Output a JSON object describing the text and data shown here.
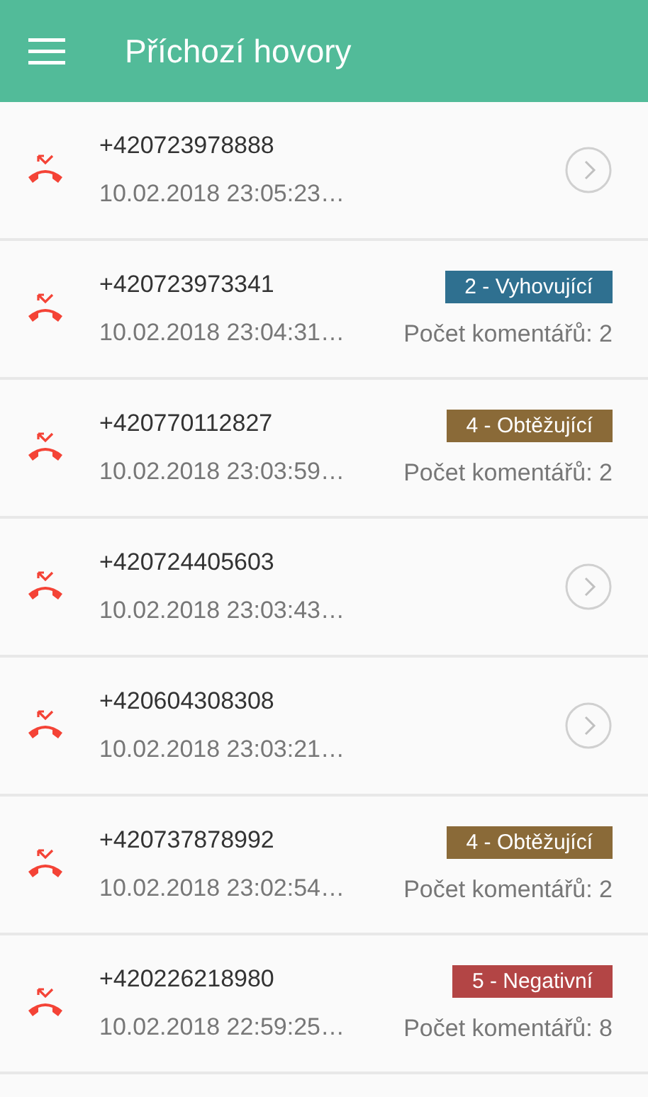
{
  "header": {
    "title": "Příchozí hovory"
  },
  "calls": [
    {
      "kind": "plain",
      "number": "+420723978888",
      "time": "10.02.2018 23:05:23…"
    },
    {
      "kind": "rated",
      "number": "+420723973341",
      "time": "10.02.2018 23:04:31…",
      "tag": "2 - Vyhovující",
      "color": "#2f7090",
      "comments": "Počet komentářů: 2"
    },
    {
      "kind": "rated",
      "number": "+420770112827",
      "time": "10.02.2018 23:03:59…",
      "tag": "4 - Obtěžující",
      "color": "#8a6a38",
      "comments": "Počet komentářů: 2"
    },
    {
      "kind": "plain",
      "number": "+420724405603",
      "time": "10.02.2018 23:03:43…"
    },
    {
      "kind": "plain",
      "number": "+420604308308",
      "time": "10.02.2018 23:03:21…"
    },
    {
      "kind": "rated",
      "number": "+420737878992",
      "time": "10.02.2018 23:02:54…",
      "tag": "4 - Obtěžující",
      "color": "#8a6a38",
      "comments": "Počet komentářů: 2"
    },
    {
      "kind": "rated",
      "number": "+420226218980",
      "time": "10.02.2018 22:59:25…",
      "tag": "5 - Negativní",
      "color": "#b34545",
      "comments": "Počet komentářů: 8"
    }
  ]
}
